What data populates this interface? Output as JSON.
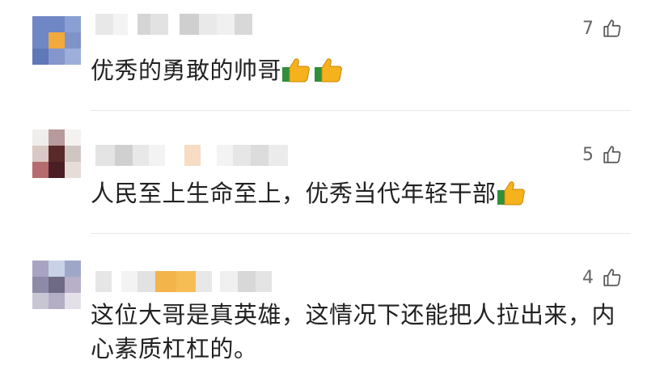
{
  "comments": [
    {
      "text": "优秀的勇敢的帅哥",
      "emoji_count": 2,
      "emoji": "thumbs-up",
      "likes": "7"
    },
    {
      "text": "人民至上生命至上，优秀当代年轻干部",
      "emoji_count": 1,
      "emoji": "thumbs-up",
      "likes": "5"
    },
    {
      "text_line1": "这位大哥是真英雄，这情况下还能把人拉出来，内",
      "text_line2": "心素质杠杠的。",
      "likes": "4"
    }
  ],
  "icons": {
    "like": "thumbs-up-outline-icon"
  },
  "colors": {
    "text": "#222222",
    "meta": "#666666",
    "divider": "#e9e9e9"
  }
}
